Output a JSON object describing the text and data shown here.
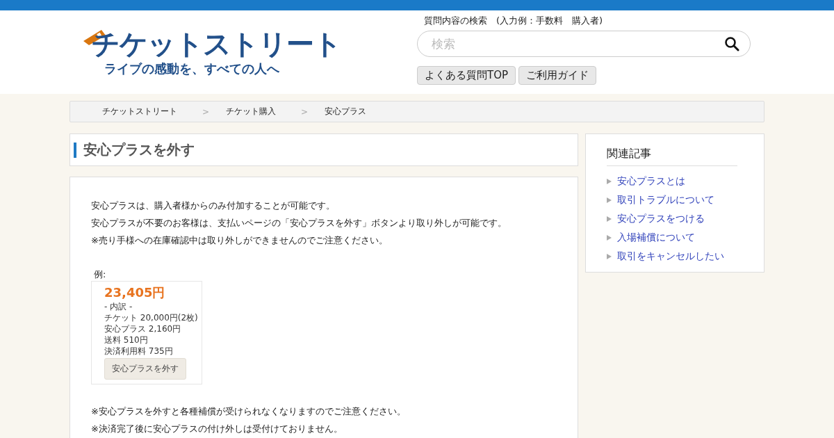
{
  "header": {
    "logo": {
      "name": "チケットストリート",
      "tagline": "ライブの感動を、すべての人へ"
    },
    "search": {
      "label": "質問内容の検索　(入力例：手数料　購入者)",
      "placeholder": "検索"
    },
    "buttons": [
      "よくある質問TOP",
      "ご利用ガイド"
    ]
  },
  "breadcrumb": [
    "チケットストリート",
    "チケット購入",
    "安心プラス"
  ],
  "breadcrumb_separator": ">",
  "article": {
    "title": "安心プラスを外す",
    "paragraphs": [
      "安心プラスは、購入者様からのみ付加することが可能です。",
      "安心プラスが不要のお客様は、支払いページの「安心プラスを外す」ボタンより取り外しが可能です。",
      "※売り手様への在庫確認中は取り外しができませんのでご注意ください。"
    ],
    "example": {
      "label": "例:",
      "total": "23,405円",
      "lines": [
        "- 内訳 -",
        "チケット 20,000円(2枚)",
        "安心プラス 2,160円",
        "送料 510円",
        "決済利用料 735円"
      ],
      "button": "安心プラスを外す"
    },
    "notes": [
      "※安心プラスを外すと各種補償が受けられなくなりますのでご注意ください。",
      "※決済完了後に安心プラスの付け外しは受付けておりません。"
    ]
  },
  "sidebar": {
    "title": "関連記事",
    "links": [
      "安心プラスとは",
      "取引トラブルについて",
      "安心プラスをつける",
      "入場補償について",
      "取引をキャンセルしたい"
    ]
  }
}
